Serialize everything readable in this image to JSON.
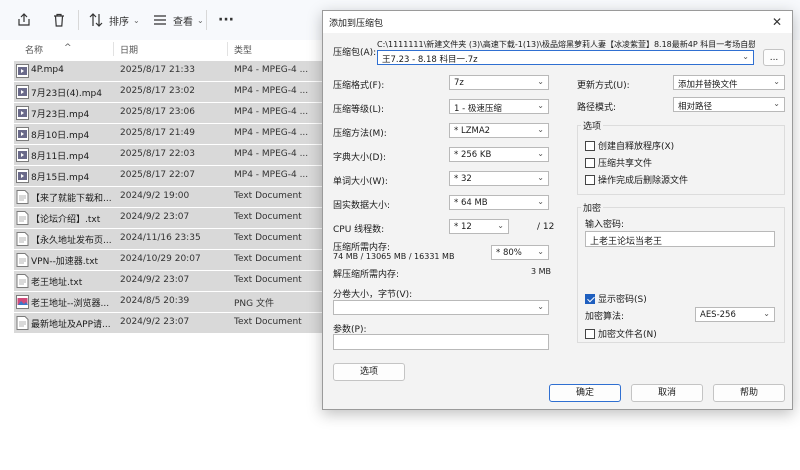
{
  "toolbar": {
    "sort_label": "排序",
    "view_label": "查看",
    "more_label": "···"
  },
  "columns": {
    "name": "名称",
    "date": "日期",
    "type": "类型"
  },
  "files": [
    {
      "name": "4P.mp4",
      "date": "2025/8/17 21:33",
      "type": "MP4 - MPEG-4 ...",
      "icon": "video"
    },
    {
      "name": "7月23日(4).mp4",
      "date": "2025/8/17 23:02",
      "type": "MP4 - MPEG-4 ...",
      "icon": "video"
    },
    {
      "name": "7月23日.mp4",
      "date": "2025/8/17 23:06",
      "type": "MP4 - MPEG-4 ...",
      "icon": "video"
    },
    {
      "name": "8月10日.mp4",
      "date": "2025/8/17 21:49",
      "type": "MP4 - MPEG-4 ...",
      "icon": "video"
    },
    {
      "name": "8月11日.mp4",
      "date": "2025/8/17 22:03",
      "type": "MP4 - MPEG-4 ...",
      "icon": "video"
    },
    {
      "name": "8月15日.mp4",
      "date": "2025/8/17 22:07",
      "type": "MP4 - MPEG-4 ...",
      "icon": "video"
    },
    {
      "name": "【来了就能下载和...",
      "date": "2024/9/2 19:00",
      "type": "Text Document",
      "icon": "text"
    },
    {
      "name": "【论坛介绍】.txt",
      "date": "2024/9/2 23:07",
      "type": "Text Document",
      "icon": "text"
    },
    {
      "name": "【永久地址发布页...",
      "date": "2024/11/16 23:35",
      "type": "Text Document",
      "icon": "text"
    },
    {
      "name": "VPN--加速器.txt",
      "date": "2024/10/29 20:07",
      "type": "Text Document",
      "icon": "text"
    },
    {
      "name": "老王地址.txt",
      "date": "2024/9/2 23:07",
      "type": "Text Document",
      "icon": "text"
    },
    {
      "name": "老王地址--浏览器...",
      "date": "2024/8/5 20:39",
      "type": "PNG 文件",
      "icon": "image"
    },
    {
      "name": "最新地址及APP请...",
      "date": "2024/9/2 23:07",
      "type": "Text Document",
      "icon": "text"
    }
  ],
  "dialog": {
    "title": "添加到压缩包",
    "archive_label": "压缩包(A):",
    "archive_path_line1": "C:\\1111111\\新建文件夹 (3)\\高速下载-1(13)\\极品熔黑萝莉人妻【冰凌紫萱】8.18最新4P 科目一考场自慰\\",
    "archive_path_line2": "王7.23 - 8.18  科目一.7z",
    "browse_label": "...",
    "format_label": "压缩格式(F):",
    "format_value": "7z",
    "level_label": "压缩等级(L):",
    "level_value": "1 - 极速压缩",
    "method_label": "压缩方法(M):",
    "method_value": "* LZMA2",
    "dict_label": "字典大小(D):",
    "dict_value": "* 256 KB",
    "word_label": "单词大小(W):",
    "word_value": "* 32",
    "solid_label": "固实数据大小:",
    "solid_value": "* 64 MB",
    "cpu_label": "CPU 线程数:",
    "cpu_value": "* 12",
    "cpu_total": "/ 12",
    "mem_compress_label": "压缩所需内存:",
    "mem_compress_value": "74 MB / 13065 MB / 16331 MB",
    "mem_percent_value": "* 80%",
    "mem_decompress_label": "解压缩所需内存:",
    "mem_decompress_value": "3 MB",
    "split_label": "分卷大小，字节(V):",
    "split_value": "",
    "params_label": "参数(P):",
    "params_value": "",
    "options_button": "选项",
    "update_label": "更新方式(U):",
    "update_value": "添加并替换文件",
    "path_mode_label": "路径模式:",
    "path_mode_value": "相对路径",
    "options_group": "选项",
    "opt_sfx": "创建自释放程序(X)",
    "opt_shared": "压缩共享文件",
    "opt_delete": "操作完成后删除源文件",
    "encrypt_group": "加密",
    "password_label": "输入密码:",
    "password_value": "上老王论坛当老王",
    "show_password": "显示密码(S)",
    "enc_method_label": "加密算法:",
    "enc_method_value": "AES-256",
    "encrypt_names": "加密文件名(N)",
    "ok_button": "确定",
    "cancel_button": "取消",
    "help_button": "帮助"
  },
  "colors": {
    "accent": "#2f6fd1",
    "selected_row": "#d9d9d9",
    "dialog_bg": "#f3f3f3"
  }
}
